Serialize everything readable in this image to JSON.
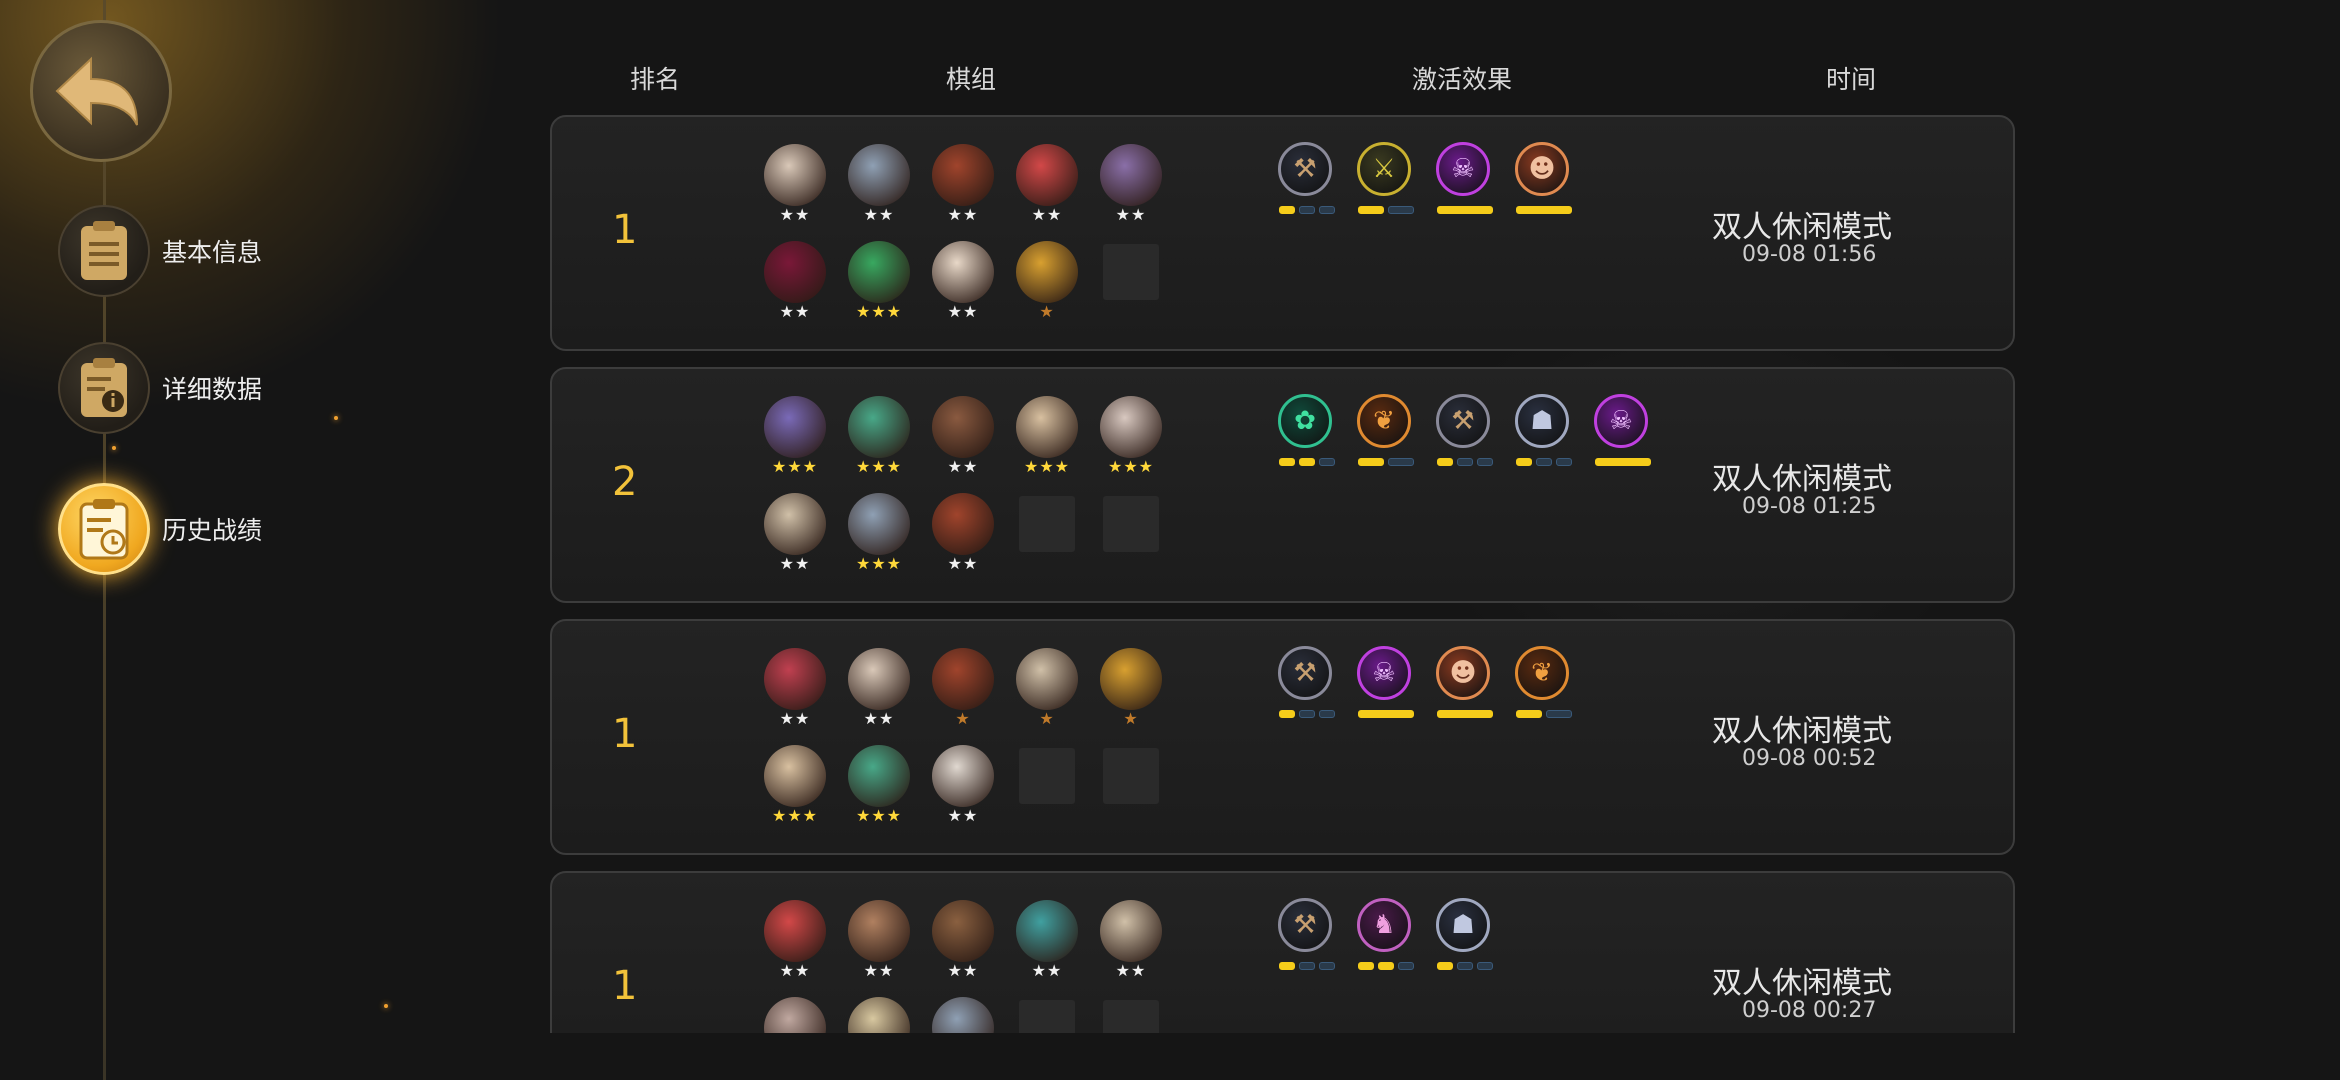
{
  "header": {
    "rank": "排名",
    "lineup": "棋组",
    "effects": "激活效果",
    "time": "时间"
  },
  "nav": {
    "items": [
      {
        "label": "基本信息",
        "icon": "clipboard-icon",
        "active": false
      },
      {
        "label": "详细数据",
        "icon": "clipboard-info-icon",
        "active": false
      },
      {
        "label": "历史战绩",
        "icon": "clipboard-clock-icon",
        "active": true
      }
    ]
  },
  "records": [
    {
      "rank": "1",
      "mode": "双人休闲模式",
      "time": "09-08 01:56",
      "pieces": [
        {
          "color": "#d9c8b8",
          "stars": 2,
          "tier": "w"
        },
        {
          "color": "#8fa0b4",
          "stars": 2,
          "tier": "w"
        },
        {
          "color": "#a0442c",
          "stars": 2,
          "tier": "w"
        },
        {
          "color": "#d24848",
          "stars": 2,
          "tier": "w"
        },
        {
          "color": "#8a6fa8",
          "stars": 2,
          "tier": "w"
        },
        {
          "color": "#7a1838",
          "stars": 2,
          "tier": "w"
        },
        {
          "color": "#38a860",
          "stars": 3,
          "tier": "g"
        },
        {
          "color": "#e8d8c8",
          "stars": 2,
          "tier": "w"
        },
        {
          "color": "#d8a030",
          "stars": 1,
          "tier": "b"
        },
        null
      ],
      "effects": [
        {
          "icon": "axe-icon",
          "ring": "#8a8a9a",
          "bg": "#2a2e3a",
          "fg": "#c8a070",
          "glyph": "⚒",
          "bars": [
            1,
            0,
            0
          ]
        },
        {
          "icon": "claw-icon",
          "ring": "#c8b030",
          "bg": "#3a3a20",
          "fg": "#d8c840",
          "glyph": "⚔",
          "bars": [
            1,
            0
          ]
        },
        {
          "icon": "demon-icon",
          "ring": "#c040e0",
          "bg": "#6a1a8a",
          "fg": "#f0c0ff",
          "glyph": "☠",
          "bars": [
            1
          ]
        },
        {
          "icon": "ogre-icon",
          "ring": "#e08a50",
          "bg": "#8a3a20",
          "fg": "#f0c0a0",
          "glyph": "☻",
          "bars": [
            1
          ]
        }
      ]
    },
    {
      "rank": "2",
      "mode": "双人休闲模式",
      "time": "09-08 01:25",
      "pieces": [
        {
          "color": "#7a6ab8",
          "stars": 3,
          "tier": "g"
        },
        {
          "color": "#48a888",
          "stars": 3,
          "tier": "g"
        },
        {
          "color": "#8a5a40",
          "stars": 2,
          "tier": "w"
        },
        {
          "color": "#d8c0a0",
          "stars": 3,
          "tier": "g"
        },
        {
          "color": "#d8c8c0",
          "stars": 3,
          "tier": "g"
        },
        {
          "color": "#d0c0a8",
          "stars": 2,
          "tier": "w"
        },
        {
          "color": "#8fa0b4",
          "stars": 3,
          "tier": "g"
        },
        {
          "color": "#a0442c",
          "stars": 2,
          "tier": "w"
        },
        null,
        null
      ],
      "effects": [
        {
          "icon": "paw-icon",
          "ring": "#30c090",
          "bg": "#104a3a",
          "fg": "#40e0a0",
          "glyph": "✿",
          "bars": [
            1,
            1,
            0
          ]
        },
        {
          "icon": "leaf-icon",
          "ring": "#e08a30",
          "bg": "#5a2a10",
          "fg": "#f0a040",
          "glyph": "❦",
          "bars": [
            1,
            0
          ]
        },
        {
          "icon": "axe-icon",
          "ring": "#8a8a9a",
          "bg": "#2a2e3a",
          "fg": "#c8a070",
          "glyph": "⚒",
          "bars": [
            1,
            0,
            0
          ]
        },
        {
          "icon": "knight-helm-icon",
          "ring": "#a0a8c0",
          "bg": "#2a3040",
          "fg": "#c0c8e0",
          "glyph": "☗",
          "bars": [
            1,
            0,
            0
          ]
        },
        {
          "icon": "demon-icon",
          "ring": "#c040e0",
          "bg": "#6a1a8a",
          "fg": "#f0c0ff",
          "glyph": "☠",
          "bars": [
            1
          ]
        }
      ]
    },
    {
      "rank": "1",
      "mode": "双人休闲模式",
      "time": "09-08 00:52",
      "pieces": [
        {
          "color": "#c04050",
          "stars": 2,
          "tier": "w"
        },
        {
          "color": "#d9c8b8",
          "stars": 2,
          "tier": "w"
        },
        {
          "color": "#a0442c",
          "stars": 1,
          "tier": "b"
        },
        {
          "color": "#d0c0a8",
          "stars": 1,
          "tier": "b"
        },
        {
          "color": "#d8a030",
          "stars": 1,
          "tier": "b"
        },
        {
          "color": "#d8c0a0",
          "stars": 3,
          "tier": "g"
        },
        {
          "color": "#48a888",
          "stars": 3,
          "tier": "g"
        },
        {
          "color": "#e0d8d0",
          "stars": 2,
          "tier": "w"
        },
        null,
        null
      ],
      "effects": [
        {
          "icon": "axe-icon",
          "ring": "#8a8a9a",
          "bg": "#2a2e3a",
          "fg": "#c8a070",
          "glyph": "⚒",
          "bars": [
            1,
            0,
            0
          ]
        },
        {
          "icon": "demon-icon",
          "ring": "#c040e0",
          "bg": "#6a1a8a",
          "fg": "#f0c0ff",
          "glyph": "☠",
          "bars": [
            1
          ]
        },
        {
          "icon": "ogre-icon",
          "ring": "#e08a50",
          "bg": "#8a3a20",
          "fg": "#f0c0a0",
          "glyph": "☻",
          "bars": [
            1
          ]
        },
        {
          "icon": "leaf-icon",
          "ring": "#e08a30",
          "bg": "#5a2a10",
          "fg": "#f0a040",
          "glyph": "❦",
          "bars": [
            1,
            0
          ]
        }
      ]
    },
    {
      "rank": "1",
      "mode": "双人休闲模式",
      "time": "09-08 00:27",
      "pieces": [
        {
          "color": "#d24848",
          "stars": 2,
          "tier": "w"
        },
        {
          "color": "#b08060",
          "stars": 2,
          "tier": "w"
        },
        {
          "color": "#8a6040",
          "stars": 2,
          "tier": "w"
        },
        {
          "color": "#40a0a0",
          "stars": 2,
          "tier": "w"
        },
        {
          "color": "#d0c0a8",
          "stars": 2,
          "tier": "w"
        },
        {
          "color": "#c0a8a0",
          "stars": 0,
          "tier": "w"
        },
        {
          "color": "#d8c8a0",
          "stars": 0,
          "tier": "w"
        },
        {
          "color": "#8fa0b4",
          "stars": 0,
          "tier": "w"
        },
        null,
        null
      ],
      "effects": [
        {
          "icon": "axe-icon",
          "ring": "#8a8a9a",
          "bg": "#2a2e3a",
          "fg": "#c8a070",
          "glyph": "⚒",
          "bars": [
            1,
            0,
            0
          ]
        },
        {
          "icon": "knight-icon",
          "ring": "#c060c0",
          "bg": "#4a1a4a",
          "fg": "#f0a0e0",
          "glyph": "♞",
          "bars": [
            1,
            1,
            0
          ]
        },
        {
          "icon": "knight-helm-icon",
          "ring": "#a0a8c0",
          "bg": "#2a3040",
          "fg": "#c0c8e0",
          "glyph": "☗",
          "bars": [
            1,
            0,
            0
          ]
        }
      ]
    }
  ]
}
